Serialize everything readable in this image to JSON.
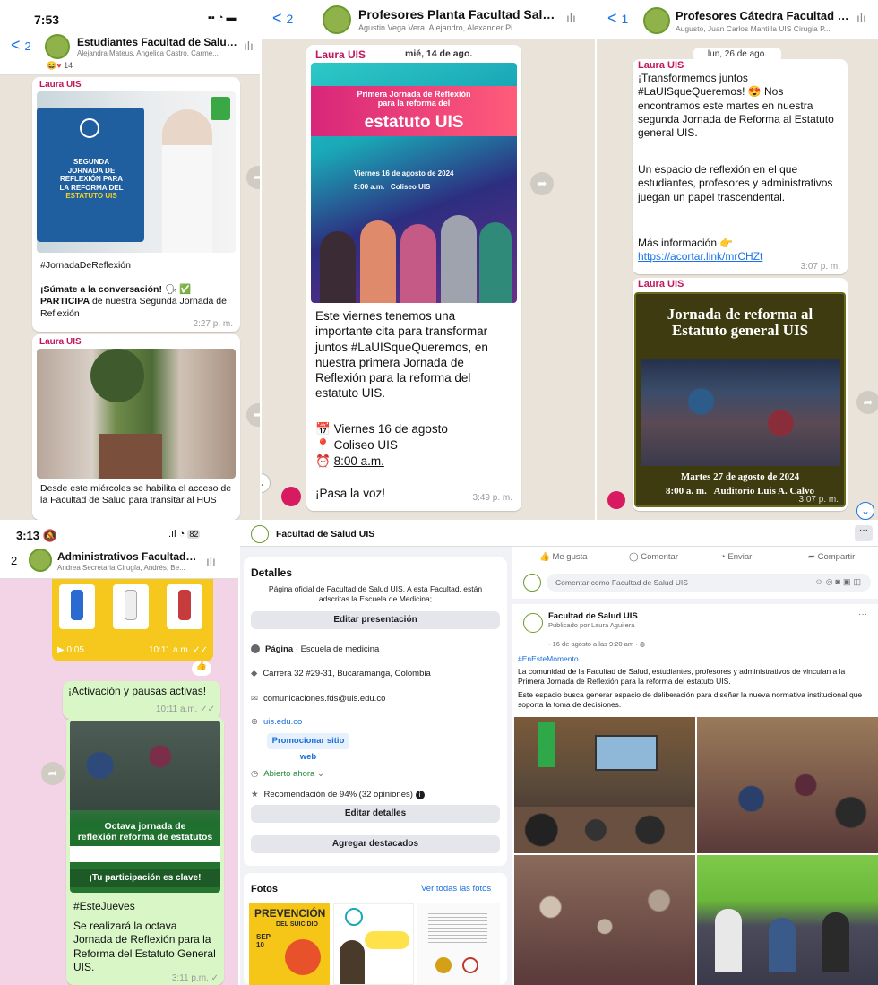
{
  "p1": {
    "status_time": "7:53",
    "back_count": "2",
    "title": "Estudiantes Facultad de Salud...",
    "subtitle": "Alejandra Mateus, Angelica Castro, Carme...",
    "reaction_count": "14",
    "m1_sender": "Laura UIS",
    "poster1": {
      "l1": "SEGUNDA",
      "l2": "JORNADA DE",
      "l3": "REFLEXIÓN PARA",
      "l4": "LA REFORMA DEL",
      "l5": "ESTATUTO UIS"
    },
    "m1_tag": "#JornadaDeReflexión",
    "m1_bold": "¡Súmate a la conversación!",
    "m1_bold2": "PARTICIPA",
    "m1_rest": "de nuestra Segunda Jornada de Reflexión",
    "m1_time": "2:27 p. m.",
    "m2_sender": "Laura UIS",
    "m2_text": "Desde este miércoles se habilita el acceso de la Facultad de Salud para transitar al HUS"
  },
  "p2": {
    "back_count": "2",
    "title": "Profesores Planta Facultad Salu...",
    "subtitle": "Agustin Vega Vera, Alejandro, Alexander Pi...",
    "sender": "Laura UIS",
    "date": "mié, 14 de ago.",
    "poster": {
      "l1": "Primera Jornada de Reflexión",
      "l2": "para la reforma del",
      "l3": "estatuto UIS",
      "d1": "Viernes 16 de agosto de 2024",
      "d2": "8:00 a.m.",
      "d3": "Coliseo UIS"
    },
    "text": "Este viernes tenemos una importante cita para transformar juntos #LaUISqueQueremos, en nuestra primera Jornada de Reflexión para la reforma del estatuto UIS.",
    "l1": "Viernes 16 de agosto",
    "l2": "Coliseo UIS",
    "l3": "8:00 a.m.",
    "closing": "¡Pasa la voz!",
    "time": "3:49 p. m."
  },
  "p3": {
    "back_count": "1",
    "title": "Profesores Cátedra Facultad de...",
    "subtitle": "Augusto, Juan Carlos Mantilla UIS Cirugia P...",
    "date": "lun, 26 de ago.",
    "sender": "Laura UIS",
    "text1": "¡Transformemos juntos #LaUISqueQueremos!",
    "text1b": "Nos encontramos este martes en nuestra segunda Jornada de Reforma al Estatuto general UIS.",
    "text2": "Un espacio de reflexión en el que estudiantes, profesores y administrativos juegan un papel trascendental.",
    "text3": "Más información",
    "link": "https://acortar.link/mrCHZt",
    "time": "3:07 p. m.",
    "sender2": "Laura UIS",
    "poster": {
      "title1": "Jornada de reforma al",
      "title2": "Estatuto general UIS",
      "d1": "Martes 27 de agosto de 2024",
      "d2": "8:00 a. m.",
      "d3": "Auditorio Luis A. Calvo"
    },
    "time2": "3:07 p. m."
  },
  "p4": {
    "status_time": "3:13",
    "battery": "82",
    "back_count": "2",
    "title": "Administrativos Facultad Sa...",
    "subtitle": "Andrea Secretaria Cirugía, Andrés, Be...",
    "video_dur": "0:05",
    "video_time": "10:11 a.m.",
    "m1": "¡Activación y pausas activas!",
    "m1_time": "10:11 a.m.",
    "poster": {
      "l1": "Octava jornada de",
      "l2": "reflexión reforma de estatutos",
      "l3": "¡Tu participación es clave!"
    },
    "m2_tag": "#EsteJueves",
    "m2_text": "Se realizará la octava Jornada de Reflexión para la Reforma del Estatuto General UIS.",
    "m2_time": "3:11 p.m."
  },
  "p5": {
    "page_name": "Facultad de Salud UIS",
    "details_title": "Detalles",
    "intro": "Página oficial de Facultad de Salud UIS. A esta Facultad, están adscritas la Escuela de Medicina;",
    "edit_intro": "Editar presentación",
    "category_label": "Página",
    "category": " · Escuela de medicina",
    "address": "Carrera 32 #29-31, Bucaramanga, Colombia",
    "email": "comunicaciones.fds@uis.edu.co",
    "website": "uis.edu.co",
    "promote": "Promocionar sitio web",
    "open": "Abierto ahora",
    "rating": "Recomendación de 94% (32 opiniones)",
    "edit_details": "Editar detalles",
    "add_featured": "Agregar destacados",
    "photos_title": "Fotos",
    "see_all": "Ver todas las fotos",
    "thumb1": {
      "l1": "PREVENCIÓN",
      "l2": "DEL SUICIDIO",
      "l3": "SEP 10"
    },
    "like": "Me gusta",
    "comment": "Comentar",
    "send": "Enviar",
    "share": "Compartir",
    "comment_placeholder": "Comentar como Facultad de Salud UIS",
    "post_author": "Facultad de Salud UIS",
    "posted_by": "Publicado por Laura Aguilera",
    "post_date": "16 de agosto a las 9:20 am",
    "hashtag": "#EnEsteMomento",
    "post_p1": "La comunidad de la Facultad de Salud, estudiantes, profesores y administrativos de vinculan a la Primera Jornada de Reflexión para la reforma del estatuto UIS.",
    "post_p2": "Este espacio busca generar espacio de deliberación para diseñar la nueva normativa institucional que soporta la toma de decisiones."
  },
  "colors": {
    "wa_sender": "#c2185b",
    "fb_blue": "#1a6ed8",
    "uis_green": "#6d9a2e"
  }
}
